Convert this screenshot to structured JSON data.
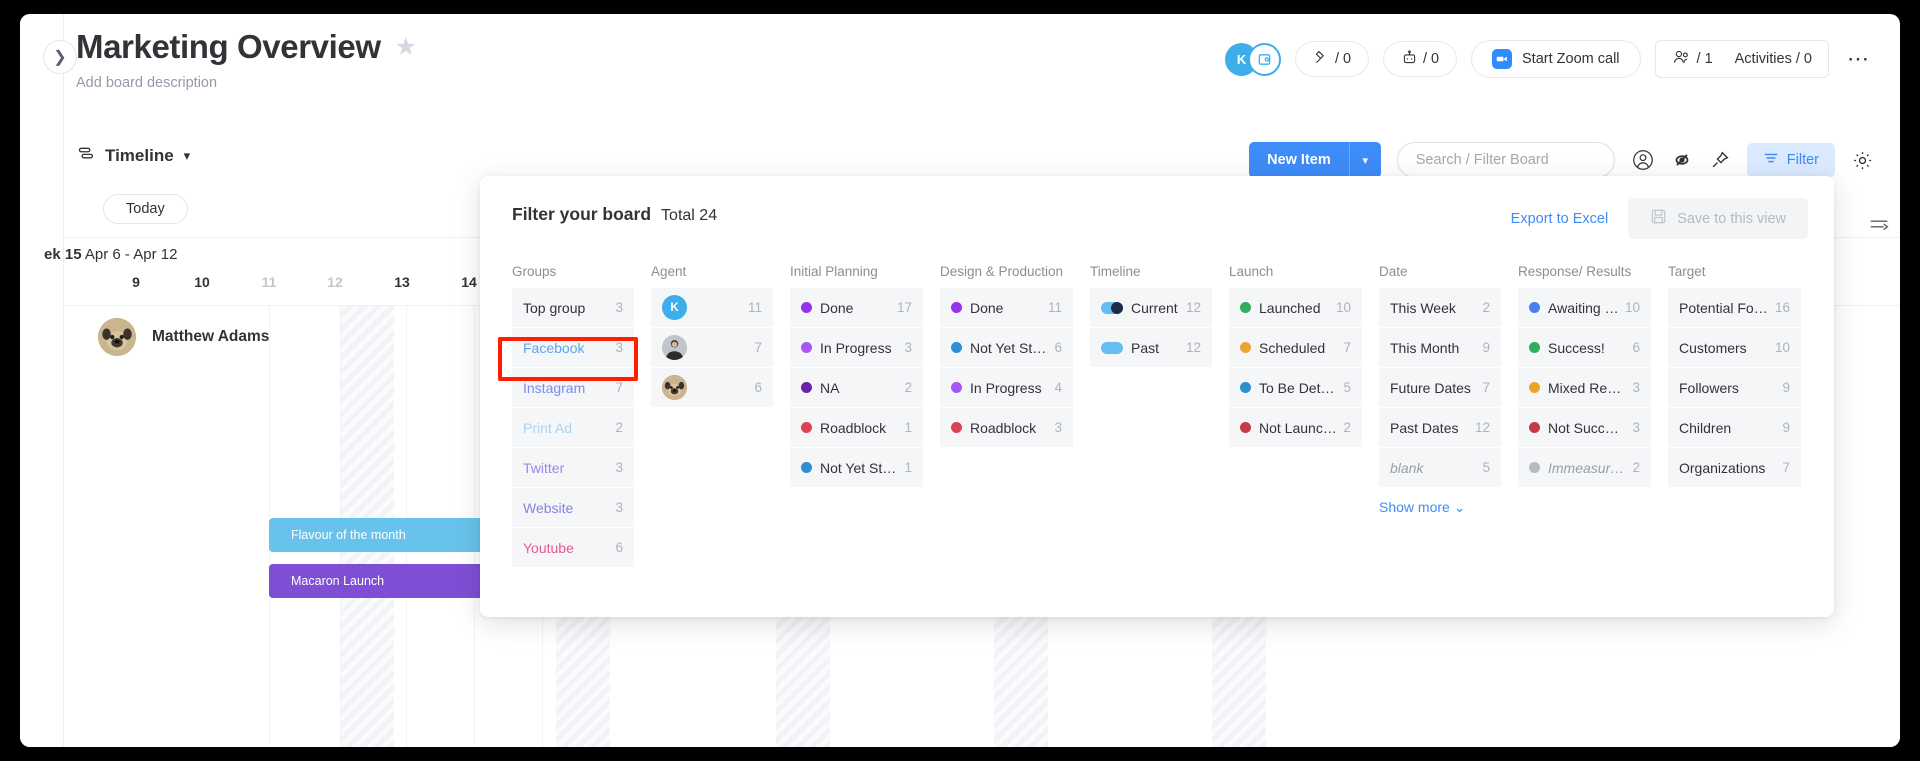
{
  "board": {
    "title": "Marketing Overview",
    "description_placeholder": "Add board description",
    "favorite_icon": "star-icon",
    "collapse_icon": "chevron-right-icon"
  },
  "header": {
    "avatar_initial": "K",
    "add_member_icon": "add-member-icon",
    "integrations": {
      "icon": "integrations-icon",
      "label": "/ 0"
    },
    "automations": {
      "icon": "automation-robot-icon",
      "label": "/ 0"
    },
    "zoom_call": {
      "icon": "zoom-video-icon",
      "label": "Start Zoom call"
    },
    "members": {
      "icon": "people-icon",
      "label": "/ 1"
    },
    "activities": {
      "label": "Activities / 0"
    },
    "more_icon": "more-options-icon"
  },
  "toolbar": {
    "view_icon": "timeline-view-icon",
    "view_name": "Timeline",
    "view_caret_icon": "chevron-down-icon",
    "new_item_label": "New Item",
    "new_item_caret_icon": "chevron-down-icon",
    "search_placeholder": "Search / Filter Board",
    "person_icon": "person-circle-icon",
    "hide_icon": "eye-hidden-icon",
    "pin_icon": "pin-icon",
    "filter_icon": "filter-lines-icon",
    "filter_label": "Filter",
    "settings_icon": "gear-icon"
  },
  "timeline": {
    "today_label": "Today",
    "week_number": "ek 15",
    "week_range": "Apr 6 - Apr 12",
    "days": [
      "9",
      "10",
      "11",
      "12",
      "13",
      "14"
    ],
    "muted_days": [
      "11",
      "12"
    ],
    "person_name": "Matthew Adams",
    "person_avatar_icon": "pug-avatar",
    "bars": [
      {
        "label": "Flavour of the month",
        "color": "#68c3ec"
      },
      {
        "label": "Macaron Launch",
        "color": "#7e4fd4"
      }
    ],
    "sort_icon": "sort-rows-icon"
  },
  "filter_panel": {
    "title": "Filter your board",
    "total_label": "Total 24",
    "export_label": "Export to Excel",
    "save_label": "Save to this view",
    "save_icon": "floppy-disk-icon",
    "show_more_label": "Show more",
    "show_more_icon": "chevron-down-icon",
    "highlighted_option": "Instagram",
    "columns": [
      {
        "title": "Groups",
        "options": [
          {
            "label": "Top group",
            "count": "3",
            "color": "#323338"
          },
          {
            "label": "Facebook",
            "count": "3",
            "color": "#5ea5f0"
          },
          {
            "label": "Instagram",
            "count": "7",
            "color": "#7a8df0"
          },
          {
            "label": "Print Ad",
            "count": "2",
            "color": "#a8d4f5"
          },
          {
            "label": "Twitter",
            "count": "3",
            "color": "#9b87e8"
          },
          {
            "label": "Website",
            "count": "3",
            "color": "#8a7fe0"
          },
          {
            "label": "Youtube",
            "count": "6",
            "color": "#e85a9a"
          }
        ]
      },
      {
        "title": "Agent",
        "options": [
          {
            "label": "",
            "count": "11",
            "avatar": "K",
            "avatar_color": "#3eaeeb"
          },
          {
            "label": "",
            "count": "7",
            "avatar": "photo",
            "avatar_color": "#b9bcc3"
          },
          {
            "label": "",
            "count": "6",
            "avatar": "pug",
            "avatar_color": "#b59a6e"
          }
        ]
      },
      {
        "title": "Initial Planning",
        "options": [
          {
            "label": "Done",
            "count": "17",
            "dot": "#9333ea"
          },
          {
            "label": "In Progress",
            "count": "3",
            "dot": "#a855f7"
          },
          {
            "label": "NA",
            "count": "2",
            "dot": "#6b21a8"
          },
          {
            "label": "Roadblock",
            "count": "1",
            "dot": "#d94452"
          },
          {
            "label": "Not Yet Star...",
            "count": "1",
            "dot": "#2e8fd1"
          }
        ]
      },
      {
        "title": "Design & Production",
        "options": [
          {
            "label": "Done",
            "count": "11",
            "dot": "#9333ea"
          },
          {
            "label": "Not Yet Star...",
            "count": "6",
            "dot": "#2e8fd1"
          },
          {
            "label": "In Progress",
            "count": "4",
            "dot": "#a855f7"
          },
          {
            "label": "Roadblock",
            "count": "3",
            "dot": "#d94452"
          }
        ]
      },
      {
        "title": "Timeline",
        "options": [
          {
            "label": "Current",
            "count": "12",
            "pill": "#66bdf2",
            "pill_type": "current"
          },
          {
            "label": "Past",
            "count": "12",
            "pill": "#66bdf2",
            "pill_type": "past"
          }
        ]
      },
      {
        "title": "Launch",
        "options": [
          {
            "label": "Launched",
            "count": "10",
            "dot": "#2eaf5e"
          },
          {
            "label": "Scheduled",
            "count": "7",
            "dot": "#eba52c"
          },
          {
            "label": "To Be Deter...",
            "count": "5",
            "dot": "#2e8fd1"
          },
          {
            "label": "Not Launch...",
            "count": "2",
            "dot": "#c63a48"
          }
        ]
      },
      {
        "title": "Date",
        "options": [
          {
            "label": "This Week",
            "count": "2"
          },
          {
            "label": "This Month",
            "count": "9"
          },
          {
            "label": "Future Dates",
            "count": "7"
          },
          {
            "label": "Past Dates",
            "count": "12"
          },
          {
            "label": "blank",
            "count": "5",
            "italic": true
          }
        ]
      },
      {
        "title": "Response/ Results",
        "options": [
          {
            "label": "Awaiting R...",
            "count": "10",
            "dot": "#4a7ef0"
          },
          {
            "label": "Success!",
            "count": "6",
            "dot": "#2eaf5e"
          },
          {
            "label": "Mixed Resul...",
            "count": "3",
            "dot": "#eba52c"
          },
          {
            "label": "Not Succes...",
            "count": "3",
            "dot": "#c63a48"
          },
          {
            "label": "Immeasura...",
            "count": "2",
            "dot": "#b6b9c0",
            "italic": true
          }
        ]
      },
      {
        "title": "Target",
        "options": [
          {
            "label": "Potential Follov",
            "count": "16"
          },
          {
            "label": "Customers",
            "count": "10"
          },
          {
            "label": "Followers",
            "count": "9"
          },
          {
            "label": "Children",
            "count": "9"
          },
          {
            "label": "Organizations",
            "count": "7"
          }
        ]
      }
    ]
  }
}
